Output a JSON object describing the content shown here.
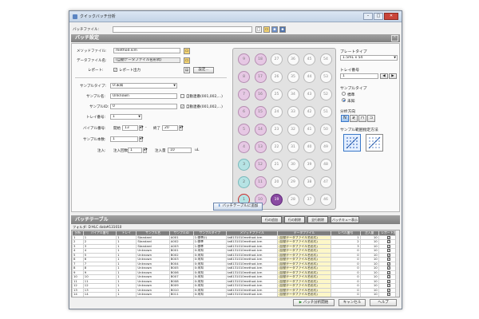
{
  "window": {
    "title": "クイックバッチ分析"
  },
  "filebar": {
    "label": "バッチファイル:",
    "value": ""
  },
  "settings_header": "バッチ設定",
  "form": {
    "method_label": "メソッドファイル:",
    "method_value": "method.lcm",
    "datafile_label": "データファイル名:",
    "datafile_value": "(自動データファイル名形式)",
    "report_label": "レポート:",
    "report_check_label": "レポート出力",
    "report_settings_btn": "設定...",
    "sampletype_label": "サンプルタイプ:",
    "sampletype_value": "0:未知",
    "samplename_label": "サンプル名:",
    "samplename_value": "Unknown",
    "auto_inc1_label": "自動連番(001,002,...)",
    "sampleid_label": "サンプルID:",
    "sampleid_value": "0",
    "auto_inc2_label": "自動連番(001,002,...)",
    "tray_label": "トレイ番号:",
    "tray_value": "1",
    "vial_label": "バイアル番号:",
    "vial_start_label": "開始",
    "vial_start_value": "13",
    "vial_dash": "-",
    "vial_end_label": "終了",
    "vial_end_value": "20",
    "repeat_label": "サンプル本数:",
    "repeat_value": "1",
    "inject_label": "注入:",
    "inject_count_label": "注入回数",
    "inject_count_value": "1",
    "inject_vol_label": "注入量",
    "inject_vol_value": "10",
    "inject_unit": "uL"
  },
  "tray": {
    "rows": [
      [
        {
          "n": "9",
          "c": "pink"
        },
        {
          "n": "18",
          "c": "pink"
        },
        {
          "n": "27",
          "c": ""
        },
        {
          "n": "36",
          "c": ""
        },
        {
          "n": "45",
          "c": ""
        },
        {
          "n": "54",
          "c": ""
        }
      ],
      [
        {
          "n": "8",
          "c": "pink"
        },
        {
          "n": "17",
          "c": "pink"
        },
        {
          "n": "26",
          "c": ""
        },
        {
          "n": "35",
          "c": ""
        },
        {
          "n": "44",
          "c": ""
        },
        {
          "n": "53",
          "c": ""
        }
      ],
      [
        {
          "n": "7",
          "c": "pink"
        },
        {
          "n": "16",
          "c": "pink"
        },
        {
          "n": "25",
          "c": ""
        },
        {
          "n": "34",
          "c": ""
        },
        {
          "n": "43",
          "c": ""
        },
        {
          "n": "52",
          "c": ""
        }
      ],
      [
        {
          "n": "6",
          "c": "pink"
        },
        {
          "n": "15",
          "c": "pink"
        },
        {
          "n": "24",
          "c": ""
        },
        {
          "n": "33",
          "c": ""
        },
        {
          "n": "42",
          "c": ""
        },
        {
          "n": "51",
          "c": ""
        }
      ],
      [
        {
          "n": "5",
          "c": "pink"
        },
        {
          "n": "14",
          "c": "pink"
        },
        {
          "n": "23",
          "c": ""
        },
        {
          "n": "32",
          "c": ""
        },
        {
          "n": "41",
          "c": ""
        },
        {
          "n": "50",
          "c": ""
        }
      ],
      [
        {
          "n": "4",
          "c": "pink"
        },
        {
          "n": "13",
          "c": "pink"
        },
        {
          "n": "22",
          "c": ""
        },
        {
          "n": "31",
          "c": ""
        },
        {
          "n": "40",
          "c": ""
        },
        {
          "n": "49",
          "c": ""
        }
      ],
      [
        {
          "n": "3",
          "c": "cyan"
        },
        {
          "n": "12",
          "c": "pink"
        },
        {
          "n": "21",
          "c": ""
        },
        {
          "n": "30",
          "c": ""
        },
        {
          "n": "39",
          "c": ""
        },
        {
          "n": "48",
          "c": ""
        }
      ],
      [
        {
          "n": "2",
          "c": "cyan"
        },
        {
          "n": "11",
          "c": "pink"
        },
        {
          "n": "20",
          "c": ""
        },
        {
          "n": "29",
          "c": ""
        },
        {
          "n": "38",
          "c": ""
        },
        {
          "n": "47",
          "c": ""
        }
      ],
      [
        {
          "n": "1",
          "c": "cyan sel"
        },
        {
          "n": "10",
          "c": "pink"
        },
        {
          "n": "19",
          "c": "purple"
        },
        {
          "n": "28",
          "c": ""
        },
        {
          "n": "37",
          "c": ""
        },
        {
          "n": "46",
          "c": ""
        }
      ]
    ]
  },
  "right": {
    "platetype_label": "プレートタイプ",
    "platetype_value": "1.5mL x 54",
    "traynum_label": "トレイ番号",
    "traynum_value": "1",
    "sampletype_label": "サンプルタイプ",
    "radio_std": "標準",
    "radio_unk": "未知",
    "direction_label": "分析方向",
    "pattern_label": "サンプル範囲指定方法"
  },
  "add_button": "バッチテーブルに追加",
  "batch": {
    "header": "バッチテーブル",
    "btn_insert": "行の追加",
    "btn_delete": "行の削除",
    "btn_deleteall": "全行削除",
    "btn_queue": "バッチキュー表示",
    "folder": "フォルダ: D:¥LC data¥131010",
    "columns": [
      "分析",
      "バイアル番号",
      "トレイ",
      "サンプル名",
      "サンプルID",
      "サンプルタイプ",
      "メソッドファイル",
      "データファイル",
      "レベル番号",
      "注入量",
      "レポート出"
    ],
    "rows": [
      [
        "1",
        "1",
        "1",
        "Standard",
        "A001",
        "1:標準(I)",
        "ta6131010method.lcm",
        "(自動データファイル名形式)",
        "1",
        "10",
        "✓"
      ],
      [
        "2",
        "2",
        "1",
        "Standard",
        "A002",
        "1:標準",
        "ta6131010method.lcm",
        "(自動データファイル名形式)",
        "2",
        "10",
        "✓"
      ],
      [
        "3",
        "3",
        "1",
        "Standard",
        "A003",
        "1:標準",
        "ta6131010method.lcm",
        "(自動データファイル名形式)",
        "3",
        "10",
        "✓"
      ],
      [
        "4",
        "4",
        "1",
        "Unknown",
        "B001",
        "0:未知",
        "ta6131010method.lcm",
        "(自動データファイル名形式)",
        "0",
        "10",
        "✓"
      ],
      [
        "5",
        "5",
        "1",
        "Unknown",
        "B002",
        "0:未知",
        "ta6131010method.lcm",
        "(自動データファイル名形式)",
        "0",
        "10",
        "✓"
      ],
      [
        "6",
        "6",
        "1",
        "Unknown",
        "B003",
        "0:未知",
        "ta6131010method.lcm",
        "(自動データファイル名形式)",
        "0",
        "10",
        "✓"
      ],
      [
        "7",
        "7",
        "1",
        "Unknown",
        "B004",
        "0:未知",
        "ta6131010method.lcm",
        "(自動データファイル名形式)",
        "0",
        "10",
        "✓"
      ],
      [
        "8",
        "8",
        "1",
        "Unknown",
        "B005",
        "0:未知",
        "ta6131010method.lcm",
        "(自動データファイル名形式)",
        "0",
        "10",
        "✓"
      ],
      [
        "9",
        "9",
        "1",
        "Unknown",
        "B006",
        "0:未知",
        "ta6131010method.lcm",
        "(自動データファイル名形式)",
        "0",
        "10",
        "✓"
      ],
      [
        "10",
        "10",
        "1",
        "Unknown",
        "B007",
        "0:未知",
        "ta6131010method.lcm",
        "(自動データファイル名形式)",
        "0",
        "10",
        "✓"
      ],
      [
        "11",
        "11",
        "1",
        "Unknown",
        "B008",
        "0:未知",
        "ta6131010method.lcm",
        "(自動データファイル名形式)",
        "0",
        "10",
        "✓"
      ],
      [
        "12",
        "12",
        "1",
        "Unknown",
        "B009",
        "0:未知",
        "ta6131010method.lcm",
        "(自動データファイル名形式)",
        "0",
        "10",
        "✓"
      ],
      [
        "13",
        "13",
        "1",
        "Unknown",
        "B010",
        "0:未知",
        "ta6131010method.lcm",
        "(自動データファイル名形式)",
        "0",
        "10",
        "✓"
      ],
      [
        "14",
        "14",
        "1",
        "Unknown",
        "B011",
        "0:未知",
        "ta6131010method.lcm",
        "(自動データファイル名形式)",
        "0",
        "10",
        "✓"
      ]
    ]
  },
  "footer": {
    "start_btn": "バッチ分析開始",
    "cancel_btn": "キャンセル",
    "help_btn": "ヘルプ"
  },
  "colors": {
    "pink": "#e6c8e4",
    "cyan": "#b6e3e4",
    "purple": "#8a4aa2",
    "header_gray": "#7f7f7f"
  }
}
